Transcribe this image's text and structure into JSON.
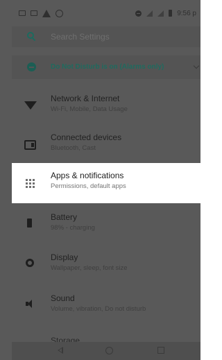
{
  "status_bar": {
    "time": "9:56 p"
  },
  "search": {
    "placeholder": "Search Settings"
  },
  "dnd_banner": {
    "label": "Do Not Disturb is on (Alarms only)"
  },
  "settings_items": [
    {
      "title": "Network & Internet",
      "subtitle": "Wi-Fi, Mobile, Data Usage",
      "icon": "wifi-icon"
    },
    {
      "title": "Connected devices",
      "subtitle": "Bluetooth, Cast",
      "icon": "devices-icon"
    },
    {
      "title": "Apps & notifications",
      "subtitle": "Permissions, default apps",
      "icon": "apps-grid-icon",
      "highlighted": true
    },
    {
      "title": "Battery",
      "subtitle": "98% - charging",
      "icon": "battery-icon"
    },
    {
      "title": "Display",
      "subtitle": "Wallpaper, sleep, font size",
      "icon": "brightness-icon"
    },
    {
      "title": "Sound",
      "subtitle": "Volume, vibration, Do not disturb",
      "icon": "volume-icon"
    }
  ],
  "peek_item": {
    "title": "Storage"
  },
  "colors": {
    "overlay": "#595959",
    "accent": "#1c6b5f",
    "highlight": "#ffffff"
  }
}
